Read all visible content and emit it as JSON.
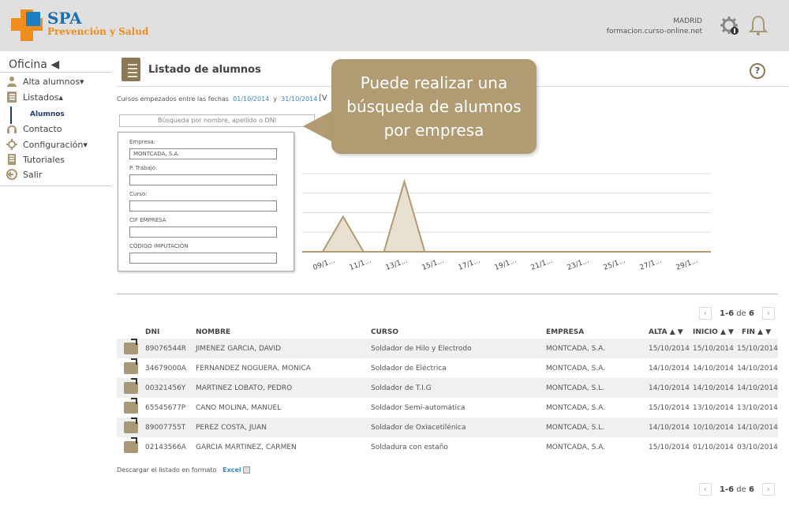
{
  "header": {
    "brand_name": "SPA",
    "brand_sub": "Prevención y Salud",
    "city": "MADRID",
    "url": "formacion.curso-online.net",
    "icons": [
      "settings-gear-icon",
      "bell-icon"
    ]
  },
  "sidebar": {
    "title": "Oficina ◀",
    "items": [
      {
        "label": "Alta alumnos▾",
        "icon": "user-icon"
      },
      {
        "label": "Listados▴",
        "icon": "list-icon"
      },
      {
        "label": "Contacto",
        "icon": "headset-icon"
      },
      {
        "label": "Configuración▾",
        "icon": "gear-icon"
      },
      {
        "label": "Tutoriales",
        "icon": "book-icon"
      },
      {
        "label": "Salir",
        "icon": "exit-icon"
      }
    ],
    "sub_selected": "Alumnos"
  },
  "main": {
    "title": "Listado de alumnos",
    "help": "?",
    "dates_prefix": "Cursos empezados entre las fechas",
    "date_from": "01/10/2014",
    "date_and": "y",
    "date_to": "31/10/2014",
    "v_link": "[V",
    "search_placeholder": "Búsqueda por nombre, apellido o DNI"
  },
  "filter": {
    "empresa_label": "Empresa:",
    "empresa_value": "MONTCADA, S.A.",
    "trabajo_label": "P. Trabajo:",
    "curso_label": "Curso:",
    "cif_label": "CIF EMPRESA",
    "codigo_label": "CÓDIGO IMPUTACIÓN"
  },
  "tooltip": {
    "line1": "Puede realizar una",
    "line2": "búsqueda de alumnos",
    "line3": "por empresa"
  },
  "chart_data": {
    "type": "area",
    "categories": [
      "09/1...",
      "11/1...",
      "13/1...",
      "15/1...",
      "17/1...",
      "19/1...",
      "21/1...",
      "23/1...",
      "25/1...",
      "27/1...",
      "29/1..."
    ],
    "values": [
      0,
      0,
      1,
      0,
      0,
      2,
      0,
      0,
      0,
      0,
      0,
      0,
      0,
      0,
      0,
      0,
      0,
      0,
      0,
      0,
      0
    ],
    "fill": "#e8e0d0",
    "stroke": "#b09b72",
    "grid": true
  },
  "pager": {
    "text_range": "1-6",
    "text_de": "de",
    "text_total": "6"
  },
  "table": {
    "headers": {
      "dni": "DNI",
      "nombre": "NOMBRE",
      "curso": "CURSO",
      "empresa": "EMPRESA",
      "alta": "ALTA ▲ ▼",
      "inicio": "INICIO ▲ ▼",
      "fin": "FIN ▲ ▼"
    },
    "rows": [
      {
        "dni": "89076544R",
        "nombre": "JIMENEZ GARCIA, DAVID",
        "curso": "Soldador de Hilo y Electrodo",
        "empresa": "MONTCADA, S.A.",
        "alta": "15/10/2014",
        "inicio": "15/10/2014",
        "fin": "15/10/2014"
      },
      {
        "dni": "34679000A",
        "nombre": "FERNANDEZ NOGUERA, MONICA",
        "curso": "Soldador de Eléctrica",
        "empresa": "MONTCADA, S.A.",
        "alta": "14/10/2014",
        "inicio": "14/10/2014",
        "fin": "14/10/2014"
      },
      {
        "dni": "00321456Y",
        "nombre": "MARTINEZ LOBATO, PEDRO",
        "curso": "Soldador de T.I.G",
        "empresa": "MONTCADA, S.L.",
        "alta": "14/10/2014",
        "inicio": "14/10/2014",
        "fin": "14/10/2014"
      },
      {
        "dni": "65545677P",
        "nombre": "CANO MOLINA, MANUEL",
        "curso": "Soldador Semi-automática",
        "empresa": "MONTCADA, S.A.",
        "alta": "15/10/2014",
        "inicio": "13/10/2014",
        "fin": "13/10/2014"
      },
      {
        "dni": "89007755T",
        "nombre": "PEREZ COSTA, JUAN",
        "curso": "Soldador de Oxiacetilénica",
        "empresa": "MONTCADA, S.L.",
        "alta": "14/10/2014",
        "inicio": "10/10/2014",
        "fin": "14/10/2014"
      },
      {
        "dni": "02143566A",
        "nombre": "GARCIA MARTINEZ, CARMEN",
        "curso": "Soldadura con estaño",
        "empresa": "MONTCADA, S.A.",
        "alta": "15/10/2014",
        "inicio": "01/10/2014",
        "fin": "03/10/2014"
      }
    ]
  },
  "export": {
    "text": "Descargar el listado en formato",
    "link": "Excel"
  }
}
